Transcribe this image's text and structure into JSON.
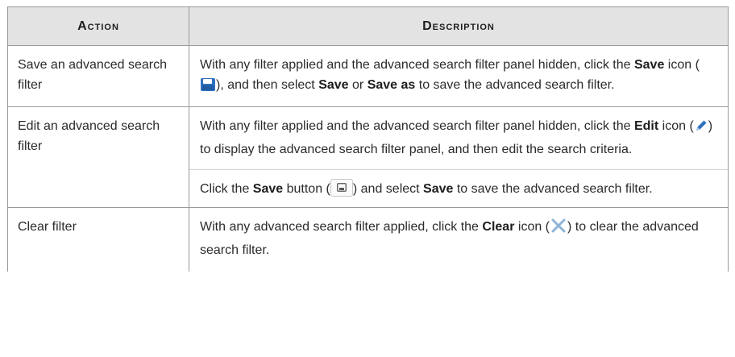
{
  "table": {
    "headers": {
      "action": "Action",
      "description": "Description"
    },
    "rows": [
      {
        "action": "Save an advanced search filter",
        "desc": {
          "t1": "With any filter applied and the advanced search filter panel hidden, click the ",
          "b1": "Save",
          "t2": " icon (",
          "t3": "), and then select ",
          "b2": "Save",
          "t4": " or ",
          "b3": "Save as",
          "t5": " to save the advanced search filter."
        }
      },
      {
        "action": "Edit an advanced search filter",
        "desc": {
          "t1": "With any filter applied and the advanced search filter panel hidden, click the ",
          "b1": "Edit",
          "t2": " icon (",
          "t3": ") to display the advanced search filter panel, and then edit the search criteria."
        },
        "desc2": {
          "t1": "Click the ",
          "b1": "Save",
          "t2": " button (",
          "t3": ") and select ",
          "b2": "Save",
          "t4": " to save the advanced search filter."
        }
      },
      {
        "action": "Clear filter",
        "desc": {
          "t1": "With any advanced search filter applied, click the ",
          "b1": "Clear",
          "t2": " icon (",
          "t3": ") to clear the advanced search filter."
        }
      }
    ]
  },
  "icons": {
    "save_icon": "save-icon",
    "edit_icon": "pencil-icon",
    "save_button_icon": "save-icon",
    "clear_icon": "close-icon"
  },
  "colors": {
    "header_bg": "#e3e3e3",
    "border": "#9a9a9a",
    "save_icon": "#2f6fbd",
    "edit_icon": "#2f6fbd",
    "clear_icon": "#8fb4d8"
  }
}
